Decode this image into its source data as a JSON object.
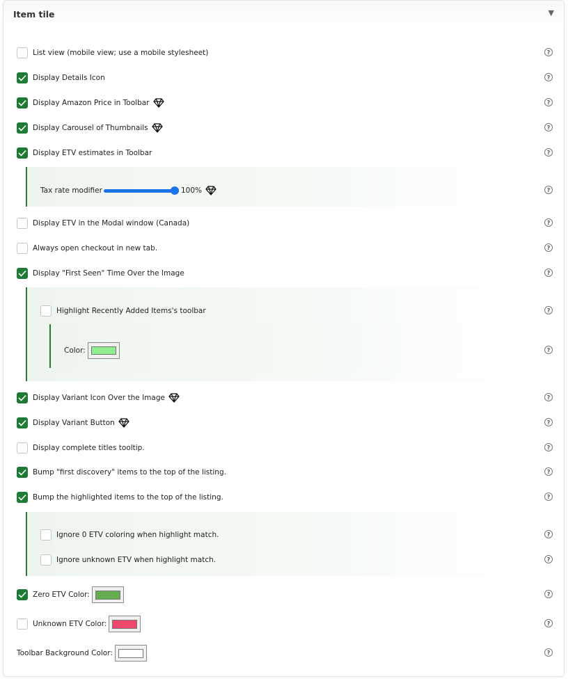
{
  "panel": {
    "title": "Item tile",
    "toggle": "▼"
  },
  "options": {
    "list_view": {
      "label": "List view (mobile view; use a mobile stylesheet)",
      "checked": false
    },
    "details_icon": {
      "label": "Display Details Icon",
      "checked": true
    },
    "amazon_price": {
      "label": "Display Amazon Price in Toolbar",
      "checked": true,
      "premium": true
    },
    "carousel": {
      "label": "Display Carousel of Thumbnails",
      "checked": true,
      "premium": true
    },
    "etv_toolbar": {
      "label": "Display ETV estimates in Toolbar",
      "checked": true
    },
    "tax_rate": {
      "label": "Tax rate modifier",
      "value_text": "100%",
      "value": 100,
      "premium": true
    },
    "etv_modal": {
      "label": "Display ETV in the Modal window (Canada)",
      "checked": false
    },
    "checkout_tab": {
      "label": "Always open checkout in new tab.",
      "checked": false
    },
    "first_seen": {
      "label": "Display \"First Seen\" Time Over the Image",
      "checked": true
    },
    "highlight_recent": {
      "label": "Highlight Recently Added Items's toolbar",
      "checked": false
    },
    "recent_color": {
      "label": "Color:",
      "color": "#90ee90"
    },
    "variant_icon": {
      "label": "Display Variant Icon Over the Image",
      "checked": true,
      "premium": true
    },
    "variant_button": {
      "label": "Display Variant Button",
      "checked": true,
      "premium": true
    },
    "titles_tooltip": {
      "label": "Display complete titles tooltip.",
      "checked": false
    },
    "bump_first": {
      "label": "Bump \"first discovery\" items to the top of the listing.",
      "checked": true
    },
    "bump_highlighted": {
      "label": "Bump the highlighted items to the top of the listing.",
      "checked": true
    },
    "ignore_zero_etv": {
      "label": "Ignore 0 ETV coloring when highlight match.",
      "checked": false
    },
    "ignore_unknown_etv": {
      "label": "Ignore unknown ETV when highlight match.",
      "checked": false
    },
    "zero_etv_color": {
      "label": "Zero ETV Color:",
      "checked": true,
      "color": "#64ad50"
    },
    "unknown_etv_color": {
      "label": "Unknown ETV Color:",
      "checked": false,
      "color": "#f0476f"
    },
    "toolbar_bg_color": {
      "label": "Toolbar Background Color:",
      "color": "#ffffff"
    }
  },
  "help_glyph": "?",
  "icons": {
    "help": "question-circle-icon",
    "premium": "diamond-icon",
    "check": "check-icon"
  },
  "colors": {
    "accent": "#1e7b36",
    "slider": "#1a73e8"
  }
}
